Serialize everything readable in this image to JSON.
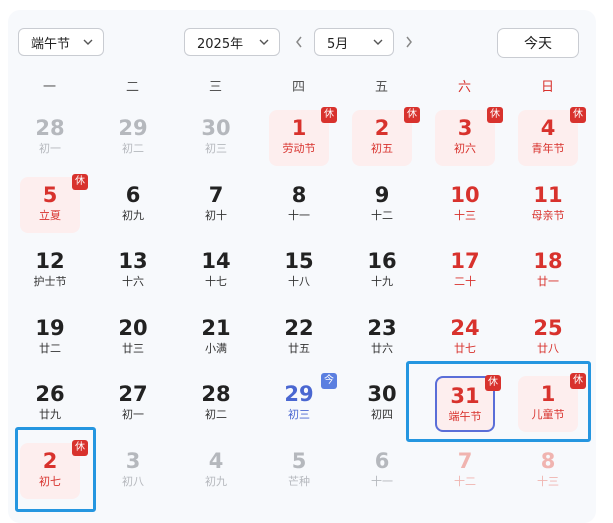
{
  "toolbar": {
    "holiday_select": "端午节",
    "year_select": "2025年",
    "month_select": "5月",
    "today_label": "今天"
  },
  "weekdays": [
    {
      "label": "一",
      "weekend": false
    },
    {
      "label": "二",
      "weekend": false
    },
    {
      "label": "三",
      "weekend": false
    },
    {
      "label": "四",
      "weekend": false
    },
    {
      "label": "五",
      "weekend": false
    },
    {
      "label": "六",
      "weekend": true
    },
    {
      "label": "日",
      "weekend": true
    }
  ],
  "days": [
    {
      "day": "28",
      "sub": "初一",
      "out": true
    },
    {
      "day": "29",
      "sub": "初二",
      "out": true
    },
    {
      "day": "30",
      "sub": "初三",
      "out": true
    },
    {
      "day": "1",
      "sub": "劳动节",
      "rest": true,
      "badge": "休"
    },
    {
      "day": "2",
      "sub": "初五",
      "rest": true,
      "badge": "休"
    },
    {
      "day": "3",
      "sub": "初六",
      "rest": true,
      "badge": "休"
    },
    {
      "day": "4",
      "sub": "青年节",
      "rest": true,
      "badge": "休"
    },
    {
      "day": "5",
      "sub": "立夏",
      "rest": true,
      "badge": "休"
    },
    {
      "day": "6",
      "sub": "初九"
    },
    {
      "day": "7",
      "sub": "初十"
    },
    {
      "day": "8",
      "sub": "十一"
    },
    {
      "day": "9",
      "sub": "十二"
    },
    {
      "day": "10",
      "sub": "十三",
      "weekend": true
    },
    {
      "day": "11",
      "sub": "母亲节",
      "weekend": true
    },
    {
      "day": "12",
      "sub": "护士节"
    },
    {
      "day": "13",
      "sub": "十六"
    },
    {
      "day": "14",
      "sub": "十七"
    },
    {
      "day": "15",
      "sub": "十八"
    },
    {
      "day": "16",
      "sub": "十九"
    },
    {
      "day": "17",
      "sub": "二十",
      "weekend": true
    },
    {
      "day": "18",
      "sub": "廿一",
      "weekend": true
    },
    {
      "day": "19",
      "sub": "廿二"
    },
    {
      "day": "20",
      "sub": "廿三"
    },
    {
      "day": "21",
      "sub": "小满"
    },
    {
      "day": "22",
      "sub": "廿五"
    },
    {
      "day": "23",
      "sub": "廿六"
    },
    {
      "day": "24",
      "sub": "廿七",
      "weekend": true
    },
    {
      "day": "25",
      "sub": "廿八",
      "weekend": true
    },
    {
      "day": "26",
      "sub": "廿九"
    },
    {
      "day": "27",
      "sub": "初一"
    },
    {
      "day": "28",
      "sub": "初二"
    },
    {
      "day": "29",
      "sub": "初三",
      "today": true,
      "badge": "今",
      "badge_color": "blue"
    },
    {
      "day": "30",
      "sub": "初四"
    },
    {
      "day": "31",
      "sub": "端午节",
      "rest": true,
      "selected": true,
      "badge": "休"
    },
    {
      "day": "1",
      "sub": "儿童节",
      "rest": true,
      "badge": "休"
    },
    {
      "day": "2",
      "sub": "初七",
      "rest": true,
      "badge": "休"
    },
    {
      "day": "3",
      "sub": "初八",
      "out": true
    },
    {
      "day": "4",
      "sub": "初九",
      "out": true
    },
    {
      "day": "5",
      "sub": "芒种",
      "out": true
    },
    {
      "day": "6",
      "sub": "十一",
      "out": true
    },
    {
      "day": "7",
      "sub": "十二",
      "out": true,
      "weekend": true
    },
    {
      "day": "8",
      "sub": "十三",
      "out": true,
      "weekend": true
    }
  ]
}
